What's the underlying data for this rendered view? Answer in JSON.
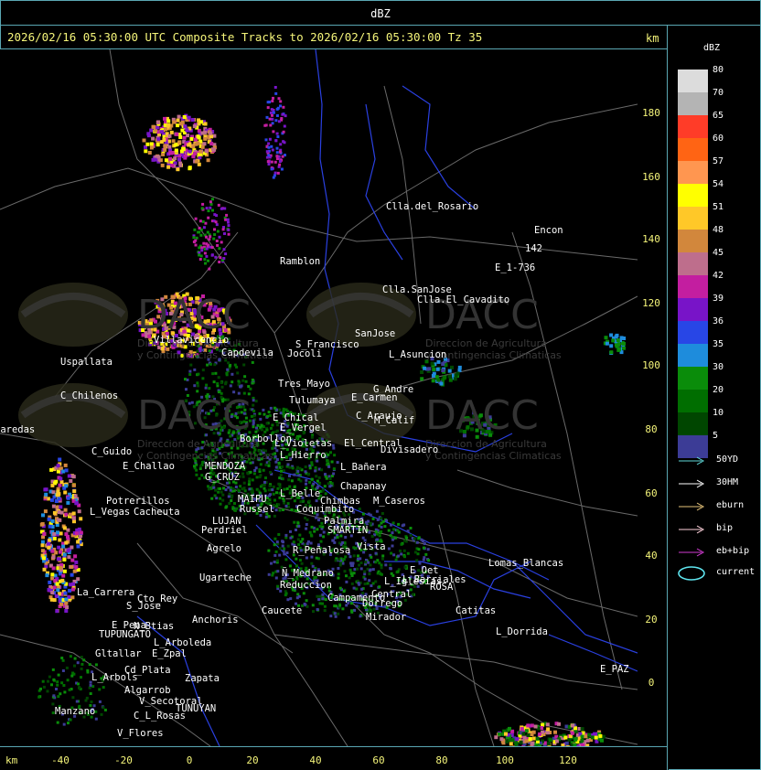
{
  "window": {
    "title": "dBZ"
  },
  "header": {
    "text": "2026/02/16 05:30:00 UTC Composite Tracks to 2026/02/16 05:30:00 Tz 35",
    "km_label": "km"
  },
  "axes": {
    "x_ticks": [
      "-40",
      "-20",
      "0",
      "20",
      "40",
      "60",
      "80",
      "100",
      "120"
    ],
    "y_ticks": [
      "180",
      "160",
      "140",
      "120",
      "100",
      "80",
      "60",
      "40",
      "20",
      "0"
    ],
    "x_unit": "km"
  },
  "legend": {
    "title": "dBZ",
    "levels": [
      {
        "label": "80",
        "color": "#dcdcdc"
      },
      {
        "label": "70",
        "color": "#b4b4b4"
      },
      {
        "label": "65",
        "color": "#ff3c28"
      },
      {
        "label": "60",
        "color": "#ff6414"
      },
      {
        "label": "57",
        "color": "#ff9650"
      },
      {
        "label": "54",
        "color": "#ffff00"
      },
      {
        "label": "51",
        "color": "#ffc828"
      },
      {
        "label": "48",
        "color": "#d2873c"
      },
      {
        "label": "45",
        "color": "#be6e8c"
      },
      {
        "label": "42",
        "color": "#c31ea0"
      },
      {
        "label": "39",
        "color": "#7814c8"
      },
      {
        "label": "36",
        "color": "#2846e6"
      },
      {
        "label": "35",
        "color": "#1e8cdc"
      },
      {
        "label": "30",
        "color": "#0a8c0a"
      },
      {
        "label": "20",
        "color": "#006e00"
      },
      {
        "label": "10",
        "color": "#004600"
      },
      {
        "label": "5",
        "color": "#3c3c96"
      }
    ],
    "tracks": [
      {
        "label": "50YD",
        "color": "#5fd7d7"
      },
      {
        "label": "30HM",
        "color": "#ffffff"
      },
      {
        "label": "eburn",
        "color": "#e6c37a"
      },
      {
        "label": "bip",
        "color": "#ffd2dc"
      },
      {
        "label": "eb+bip",
        "color": "#d23cd2"
      }
    ],
    "current": {
      "label": "current",
      "color": "#5fe6f0"
    }
  },
  "places": [
    "Clla.del_Rosario",
    "Encon",
    "142",
    "E_1-736",
    "Ramblon",
    "Clla.SanJose",
    "Clla.El_Cavadito",
    "S_Francisco",
    "SanJose",
    "L_Asuncion",
    "Uspallata",
    "Villavicencio",
    "Capdevila",
    "Jocoli",
    "Tres_Mayo",
    "G_Andre",
    "C_Chilenos",
    "Tulumaya",
    "E_Carmen",
    "C_Araujo",
    "M_Calif",
    "E_Chical",
    "E_Vergel",
    "Divisadero",
    "Paredas",
    "Borbollon",
    "L_Violetas",
    "El_Central",
    "C_Guido",
    "L_Hierro",
    "L_Bañera",
    "E_Challao",
    "MENDOZA",
    "G_CRUZ",
    "L_Belle",
    "Chapanay",
    "Potrerillos",
    "MAIPU",
    "Chimbas",
    "M_Caseros",
    "L_Vegas",
    "Cacheuta",
    "Russel",
    "Coquimbito",
    "LUJAN",
    "Palmira",
    "Perdriel",
    "SMARTIN",
    "Agrelo",
    "R_Peñalosa",
    "Ñ_Medrano",
    "Ugarteche",
    "Reduccion",
    "L_Iglesias",
    "Lomas_Blancas",
    "Cto_Rey",
    "La_Carrera",
    "S_Jose",
    "L_Barriales",
    "Catitas",
    "Anchoris",
    "E_Pena",
    "N_Btias",
    "TUPUNGATO",
    "L_Arboleda",
    "L_Dorrida",
    "Gltallar",
    "E_Zpal",
    "L_Arbols",
    "Cd_Plata",
    "Zapata",
    "E_PAZ",
    "Algarrob",
    "V_Secotoral",
    "Manzano",
    "TUNUYAN",
    "C_L_Rosas",
    "V_Flores",
    "Campamento",
    "Mirador",
    "Dorrego",
    "ROSA",
    "E_Oet",
    "Vista",
    "Central",
    "Caucete",
    "Direccion de Agricultura",
    "y Contingencias Climaticas",
    "DACC"
  ]
}
